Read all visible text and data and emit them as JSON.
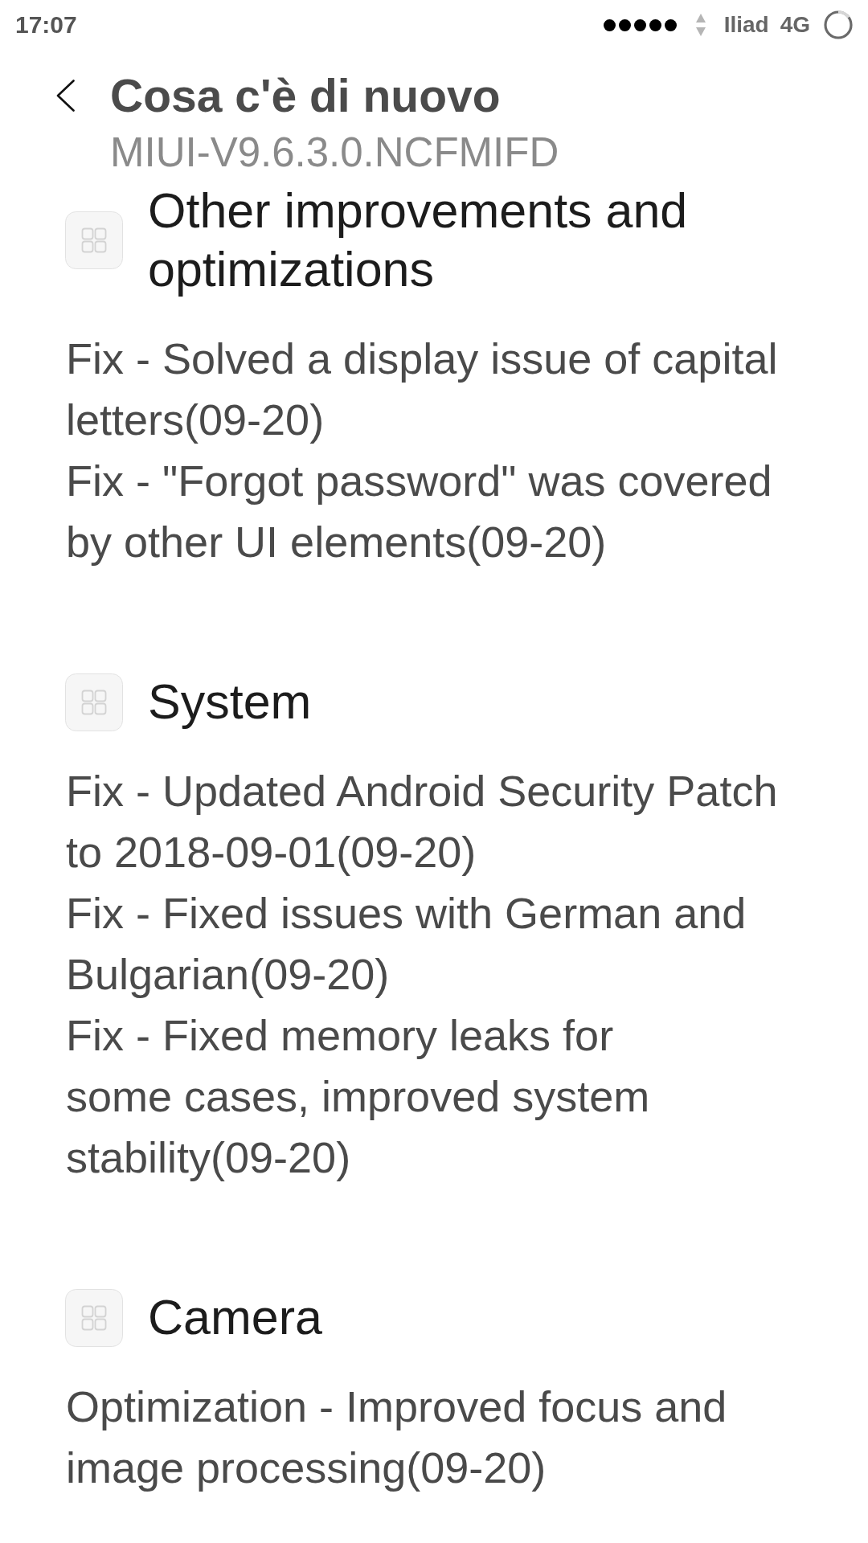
{
  "status_bar": {
    "time": "17:07",
    "carrier": "Iliad",
    "network": "4G"
  },
  "header": {
    "title": "Cosa c'è di nuovo",
    "subtitle": "MIUI-V9.6.3.0.NCFMIFD"
  },
  "sections": [
    {
      "title": "Other improvements and optimizations",
      "items": [
        "Fix - Solved a display issue of capital letters(09-20)",
        "Fix - \"Forgot password\" was covered by other UI elements(09-20)"
      ]
    },
    {
      "title": "System",
      "items": [
        "Fix - Updated Android Security Patch to 2018-09-01(09-20)",
        "Fix - Fixed issues with German and Bulgarian(09-20)",
        "Fix - Fixed memory leaks for\nsome cases, improved system stability(09-20)"
      ]
    },
    {
      "title": "Camera",
      "items": [
        "Optimization - Improved focus and image processing(09-20)"
      ]
    }
  ]
}
